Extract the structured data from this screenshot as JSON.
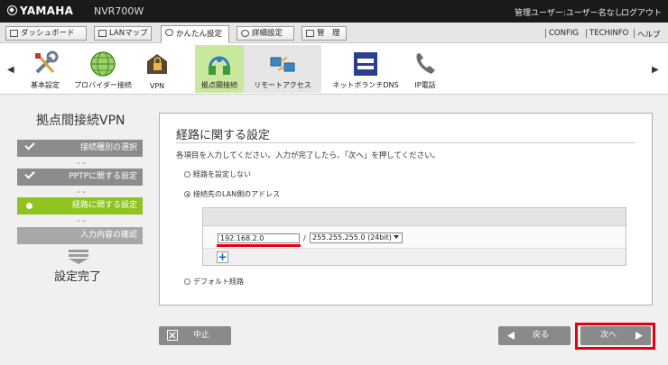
{
  "header": {
    "brand": "YAMAHA",
    "model": "NVR700W",
    "user_info": "管理ユーザー:ユーザー名なし",
    "logout": "ログアウト"
  },
  "menu": {
    "tabs": [
      {
        "label": "ダッシュボード"
      },
      {
        "label": "LANマップ"
      },
      {
        "label": "かんたん設定"
      },
      {
        "label": "詳細設定"
      },
      {
        "label": "管　理"
      }
    ],
    "right": [
      "CONFIG",
      "TECHINFO",
      "ヘルプ"
    ]
  },
  "icons": {
    "items": [
      {
        "label": "基本設定",
        "icon": "tools-icon"
      },
      {
        "label": "プロバイダー接続",
        "icon": "globe-icon"
      },
      {
        "label": "VPN",
        "icon": "vpn-lock-icon"
      },
      {
        "label": "拠点間接続",
        "icon": "site-connection-icon"
      },
      {
        "label": "リモートアクセス",
        "icon": "remote-access-icon"
      },
      {
        "label": "ネットボランチDNS",
        "icon": "ddns-icon"
      },
      {
        "label": "IP電話",
        "icon": "phone-icon"
      }
    ],
    "prev_arrow": "◀",
    "next_arrow": "▶"
  },
  "wizard": {
    "title": "拠点間接続VPN",
    "steps": [
      {
        "label": "接続種別の選択",
        "state": "done"
      },
      {
        "label": "PPTPに関する設定",
        "state": "done"
      },
      {
        "label": "経路に関する設定",
        "state": "current"
      },
      {
        "label": "入力内容の確認",
        "state": "todo"
      }
    ],
    "complete_label": "設定完了"
  },
  "panel": {
    "title": "経路に関する設定",
    "description": "各項目を入力してください。入力が完了したら、「次へ」を押してください。",
    "options": {
      "no_route": "経路を設定しない",
      "lan_address": "接続先のLAN側のアドレス",
      "default_route": "デフォルト経路"
    },
    "selected_option": "lan_address",
    "route": {
      "ip": "192.168.2.0",
      "slash": "/",
      "mask": "255.255.255.0 (24bit)",
      "add": "+"
    }
  },
  "buttons": {
    "cancel": "中止",
    "back": "戻る",
    "next": "次へ"
  },
  "colors": {
    "accent_green": "#8fc31f",
    "highlight": "#e60012"
  }
}
